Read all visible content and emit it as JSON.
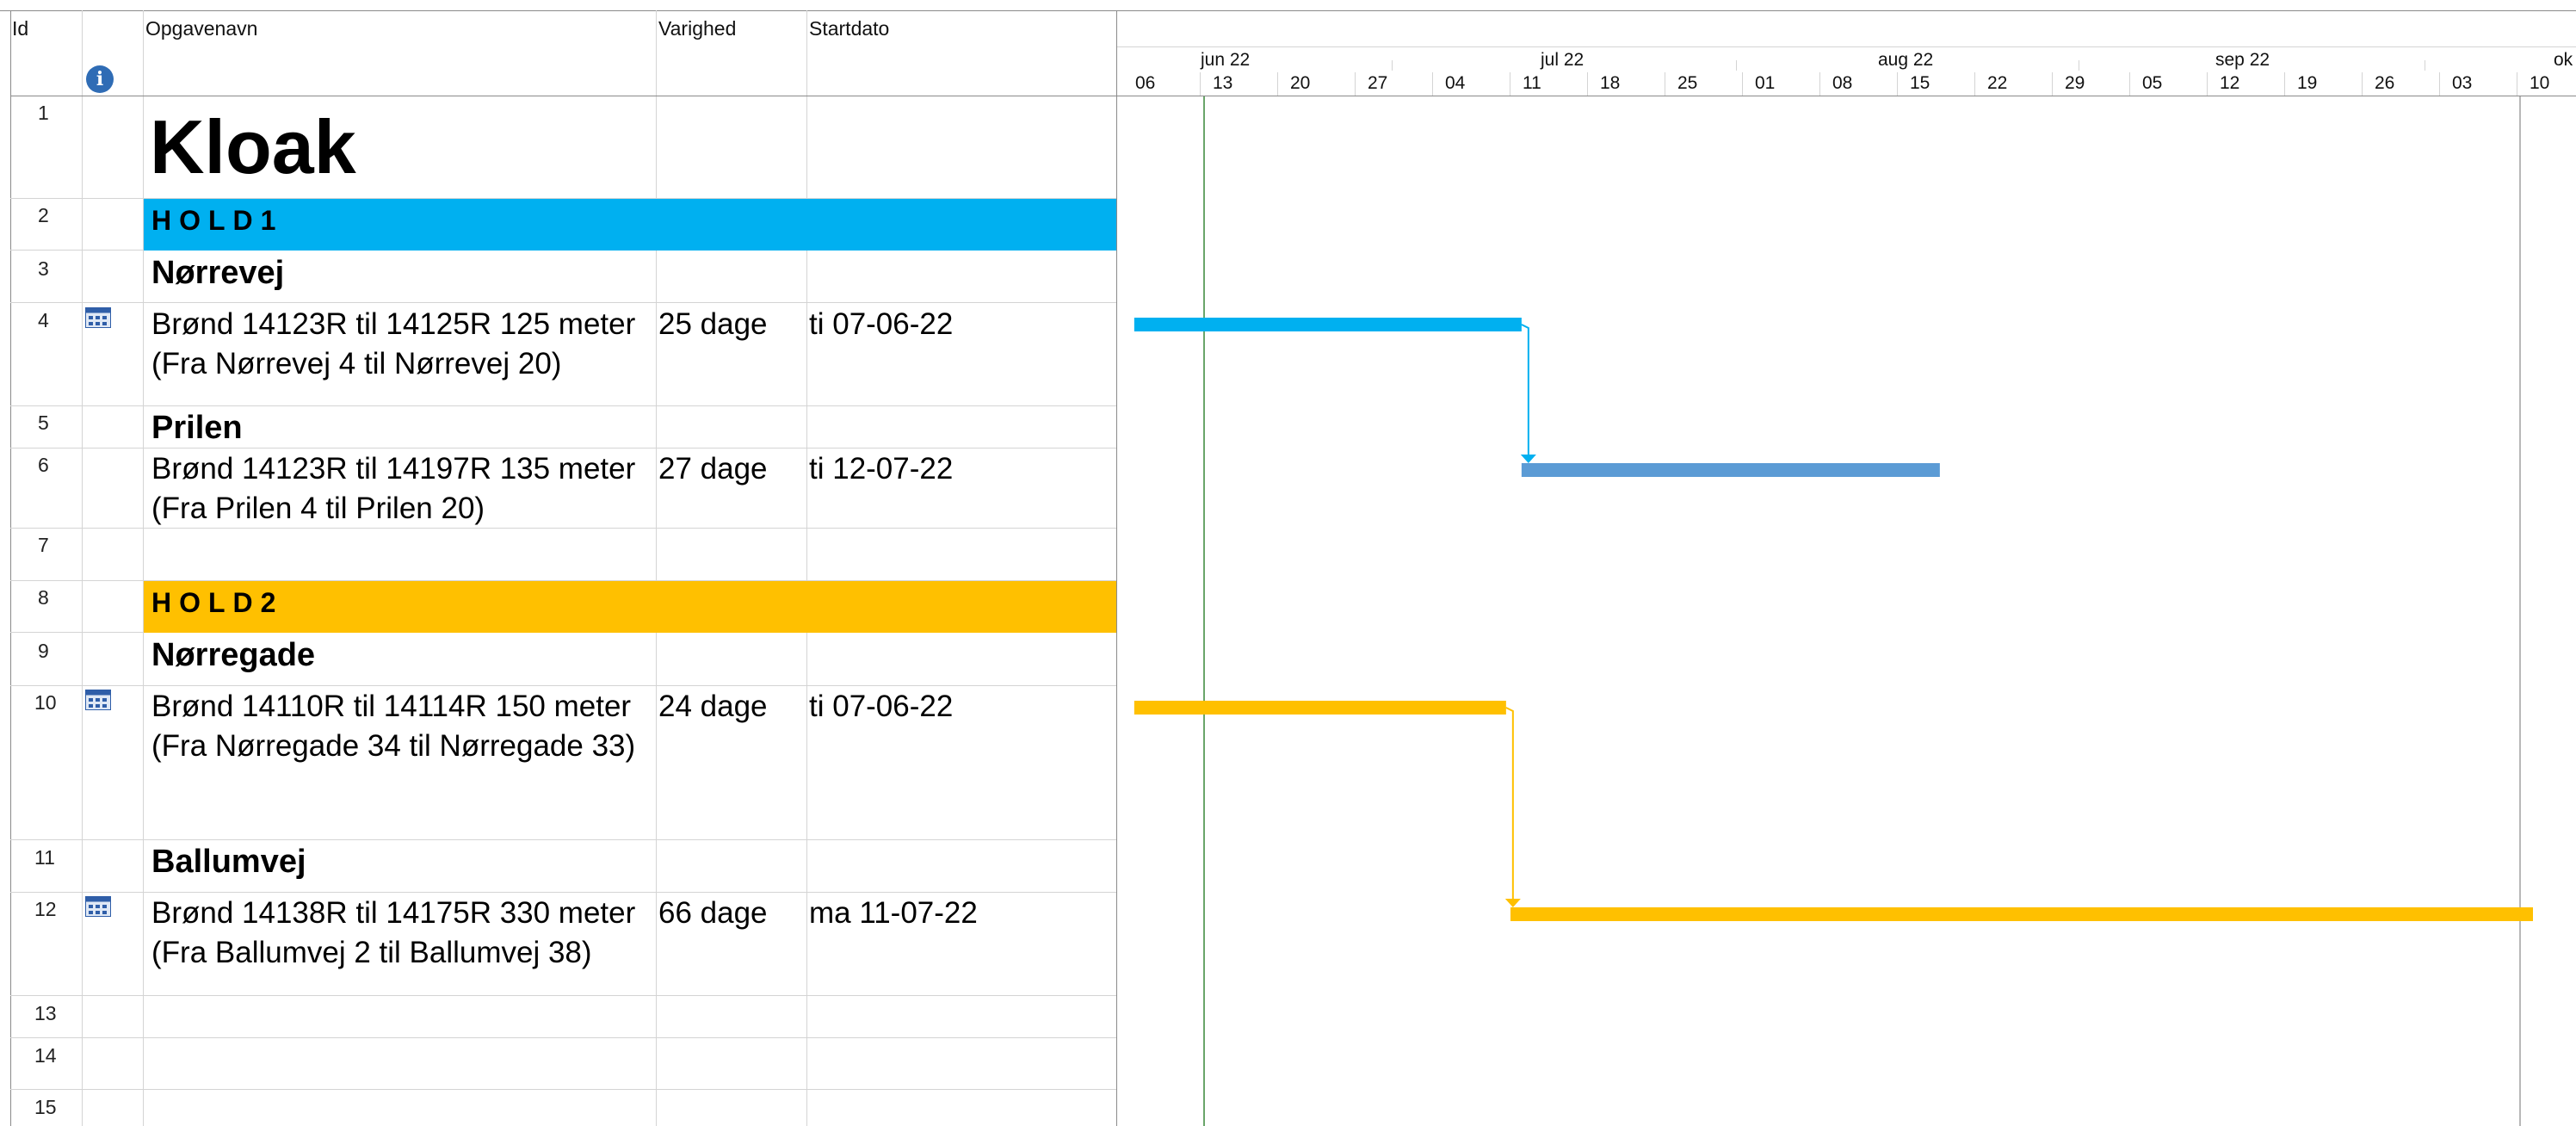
{
  "columns": {
    "id": "Id",
    "info_icon": "info-icon",
    "name": "Opgavenavn",
    "duration": "Varighed",
    "start": "Startdato"
  },
  "timescale": {
    "months": [
      "jun 22",
      "jul 22",
      "aug 22",
      "sep 22",
      "ok"
    ],
    "days": [
      "06",
      "13",
      "20",
      "27",
      "04",
      "11",
      "18",
      "25",
      "01",
      "08",
      "15",
      "22",
      "29",
      "05",
      "12",
      "19",
      "26",
      "03",
      "10"
    ]
  },
  "rows": [
    {
      "id": "1",
      "name": "Kloak",
      "style": "title"
    },
    {
      "id": "2",
      "name": "HOLD1",
      "style": "hold",
      "color": "#00B0F0"
    },
    {
      "id": "3",
      "name": "Nørrevej",
      "style": "header"
    },
    {
      "id": "4",
      "name_line1": "Brønd 14123R til 14125R 125 meter",
      "name_line2": "(Fra Nørrevej 4 til Nørrevej 20)",
      "duration": "25 dage",
      "start": "ti 07-06-22",
      "indicator": "calendar-icon"
    },
    {
      "id": "5",
      "name": "Prilen",
      "style": "header"
    },
    {
      "id": "6",
      "name_line1": "Brønd 14123R til 14197R 135 meter",
      "name_line2": "(Fra Prilen 4 til Prilen 20)",
      "duration": "27 dage",
      "start": "ti 12-07-22"
    },
    {
      "id": "7"
    },
    {
      "id": "8",
      "name": "HOLD2",
      "style": "hold",
      "color": "#FFC000"
    },
    {
      "id": "9",
      "name": "Nørregade",
      "style": "header"
    },
    {
      "id": "10",
      "name_line1": "Brønd 14110R til 14114R 150 meter",
      "name_line2": "(Fra Nørregade 34 til Nørregade 33)",
      "duration": "24 dage",
      "start": "ti 07-06-22",
      "indicator": "calendar-icon"
    },
    {
      "id": "11",
      "name": "Ballumvej",
      "style": "header"
    },
    {
      "id": "12",
      "name_line1": "Brønd 14138R til 14175R 330 meter",
      "name_line2": "(Fra Ballumvej 2 til Ballumvej 38)",
      "duration": "66 dage",
      "start": "ma 11-07-22",
      "indicator": "calendar-icon"
    },
    {
      "id": "13"
    },
    {
      "id": "14"
    },
    {
      "id": "15"
    }
  ],
  "gantt": {
    "bars": [
      {
        "task_id": "4",
        "start": "2022-06-07",
        "days": 25,
        "color": "#00B0F0"
      },
      {
        "task_id": "6",
        "start": "2022-07-12",
        "days": 27,
        "color": "#5B9BD5"
      },
      {
        "task_id": "10",
        "start": "2022-06-07",
        "days": 24,
        "color": "#FFC000"
      },
      {
        "task_id": "12",
        "start": "2022-07-11",
        "days": 66,
        "color": "#FFC000"
      }
    ],
    "links": [
      {
        "from": "4",
        "to": "6",
        "color": "#00B0F0"
      },
      {
        "from": "10",
        "to": "12",
        "color": "#FFC000"
      }
    ],
    "status_date": "2022-06-13"
  }
}
